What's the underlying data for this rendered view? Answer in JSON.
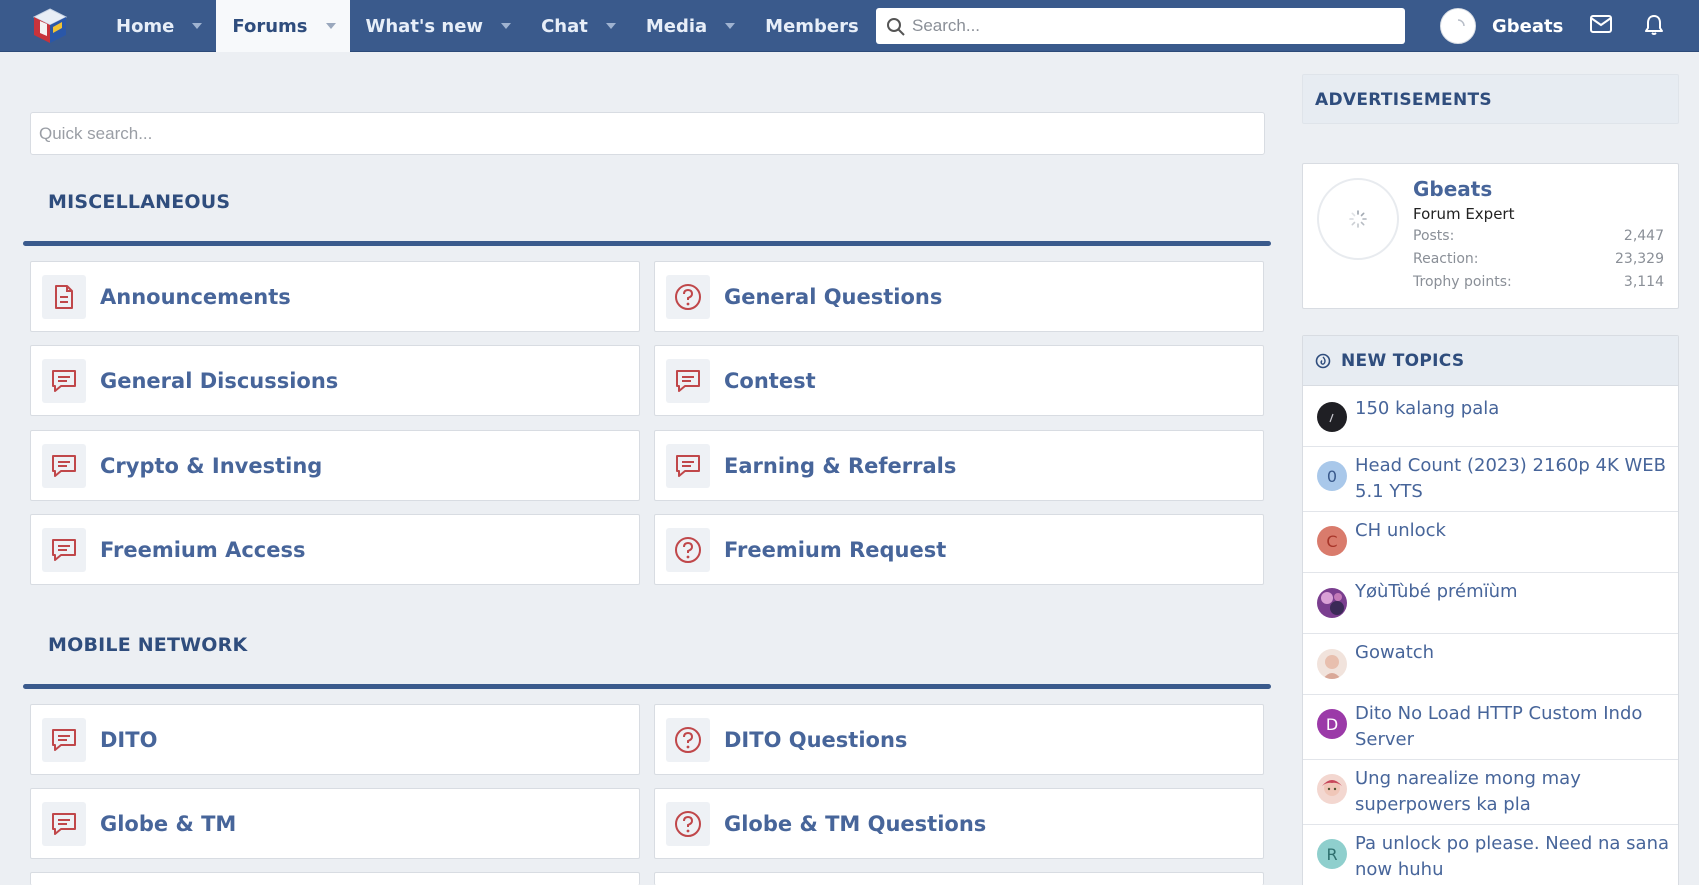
{
  "nav": {
    "tabs": [
      {
        "label": "Home"
      },
      {
        "label": "Forums"
      },
      {
        "label": "What's new"
      },
      {
        "label": "Chat"
      },
      {
        "label": "Media"
      },
      {
        "label": "Members"
      }
    ],
    "active_tab": "Forums",
    "search_placeholder": "Search...",
    "username": "Gbeats"
  },
  "main": {
    "quick_search_placeholder": "Quick search...",
    "sections": [
      {
        "title": "MISCELLANEOUS",
        "forums": [
          {
            "label": "Announcements",
            "icon": "document-icon"
          },
          {
            "label": "General Questions",
            "icon": "question-icon"
          },
          {
            "label": "General Discussions",
            "icon": "chat-icon"
          },
          {
            "label": "Contest",
            "icon": "chat-icon"
          },
          {
            "label": "Crypto & Investing",
            "icon": "chat-icon"
          },
          {
            "label": "Earning & Referrals",
            "icon": "chat-icon"
          },
          {
            "label": "Freemium Access",
            "icon": "chat-icon"
          },
          {
            "label": "Freemium Request",
            "icon": "question-icon"
          }
        ]
      },
      {
        "title": "MOBILE NETWORK",
        "forums": [
          {
            "label": "DITO",
            "icon": "chat-icon"
          },
          {
            "label": "DITO Questions",
            "icon": "question-icon"
          },
          {
            "label": "Globe & TM",
            "icon": "chat-icon"
          },
          {
            "label": "Globe & TM Questions",
            "icon": "question-icon"
          }
        ]
      }
    ]
  },
  "sidebar": {
    "ads_title": "ADVERTISEMENTS",
    "profile": {
      "name": "Gbeats",
      "role": "Forum Expert",
      "stats": [
        {
          "label": "Posts:",
          "value": "2,447"
        },
        {
          "label": "Reaction:",
          "value": "23,329"
        },
        {
          "label": "Trophy points:",
          "value": "3,114"
        }
      ]
    },
    "new_topics": {
      "title": "NEW TOPICS",
      "items": [
        {
          "title": "150 kalang pala",
          "avatar_letter": "",
          "avatar_color": "#1f1f24"
        },
        {
          "title": "Head Count (2023) 2160p 4K WEB 5.1 YTS",
          "avatar_letter": "0",
          "avatar_color": "#a9c8ea"
        },
        {
          "title": "CH unlock",
          "avatar_letter": "C",
          "avatar_color": "#d97b6c"
        },
        {
          "title": "YøùTùbé prémïùm",
          "avatar_letter": "",
          "avatar_color": "#7a3e8f"
        },
        {
          "title": "Gowatch",
          "avatar_letter": "",
          "avatar_color": "#e9cfc4"
        },
        {
          "title": "Dito No Load HTTP Custom Indo Server",
          "avatar_letter": "D",
          "avatar_color": "#9b3aa8"
        },
        {
          "title": "Ung narealize mong may superpowers ka pla",
          "avatar_letter": "",
          "avatar_color": "#e9b7b0"
        },
        {
          "title": "Pa unlock po please. Need na sana now huhu",
          "avatar_letter": "R",
          "avatar_color": "#5fa9a8"
        }
      ]
    }
  },
  "colors": {
    "nav_bg": "#3a5a8c",
    "accent_red": "#c0474a",
    "link_blue": "#47659a",
    "page_bg": "#eceff3"
  }
}
